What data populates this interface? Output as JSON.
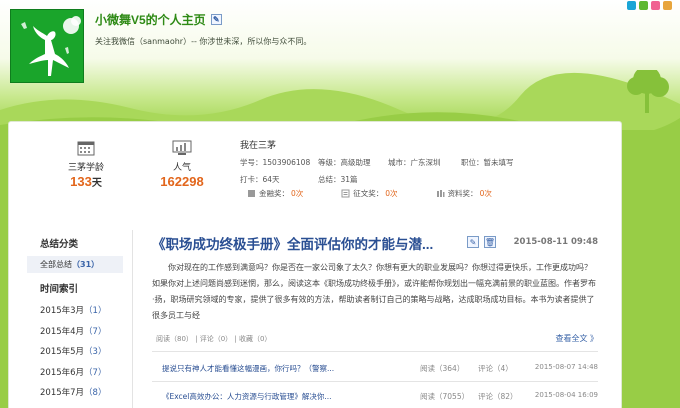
{
  "header": {
    "title": "小微舞V5的个人主页",
    "subtitle": "关注我微信（sanmaohr）-- 你涉世未深，所以你与众不同。"
  },
  "stats": {
    "age_label": "三茅学龄",
    "age_value": "133",
    "age_unit": "天",
    "pop_label": "人气",
    "pop_value": "162298"
  },
  "profile": {
    "name": "我在三茅",
    "row1": [
      "学号：1503906108",
      "等级：高级助理",
      "城市：广东深圳",
      "职位：暂未填写"
    ],
    "row2": [
      "打卡：64天",
      "总结：31篇"
    ],
    "awards": [
      {
        "label": "金融奖：",
        "value": "0次"
      },
      {
        "label": "征文奖：",
        "value": "0次"
      },
      {
        "label": "资料奖：",
        "value": "0次"
      }
    ]
  },
  "sidebar": {
    "category_heading": "总结分类",
    "all_label": "全部总结",
    "all_count": "（31）",
    "time_heading": "时间索引",
    "months": [
      {
        "label": "2015年3月",
        "count": "（1）"
      },
      {
        "label": "2015年4月",
        "count": "（7）"
      },
      {
        "label": "2015年5月",
        "count": "（3）"
      },
      {
        "label": "2015年6月",
        "count": "（7）"
      },
      {
        "label": "2015年7月",
        "count": "（8）"
      }
    ]
  },
  "post": {
    "title": "《职场成功终极手册》全面评估你的才能与潜...",
    "date": "2015-08-11 09:48",
    "body": "你对现在的工作感到满意吗？你是否在一家公司象了太久？你想有更大的职业发展吗？你想过得更快乐，工作更成功吗？如果你对上述问题尚感到迷惘，那么，阅读这本《职场成功终极手册》，或许能帮你规划出一幅充满前景的职业蓝图。作者罗布·扬，职场研究领域的专家，提供了很多有效的方法，帮助读者制订自己的策略与战略，达成职场成功目标。本书为读者提供了很多员工与经",
    "meta": "阅读（80）  |  评论（0）  |  收藏（0）",
    "more": "查看全文 》"
  },
  "list": [
    {
      "title": "提说只有神人才能看懂这幅漫画，你行吗？（警察...",
      "reads": "阅读（364）",
      "comments": "评论（4）",
      "date": "2015-08-07 14:48"
    },
    {
      "title": "《Excel高效办公：人力资源与行政管理》解决你...",
      "reads": "阅读（7055）",
      "comments": "评论（82）",
      "date": "2015-08-04 16:09"
    }
  ],
  "colors": {
    "title_green": "#2e8a15",
    "link_blue": "#2a4f93",
    "accent_orange": "#e2661c",
    "grass": "#98cd46"
  }
}
